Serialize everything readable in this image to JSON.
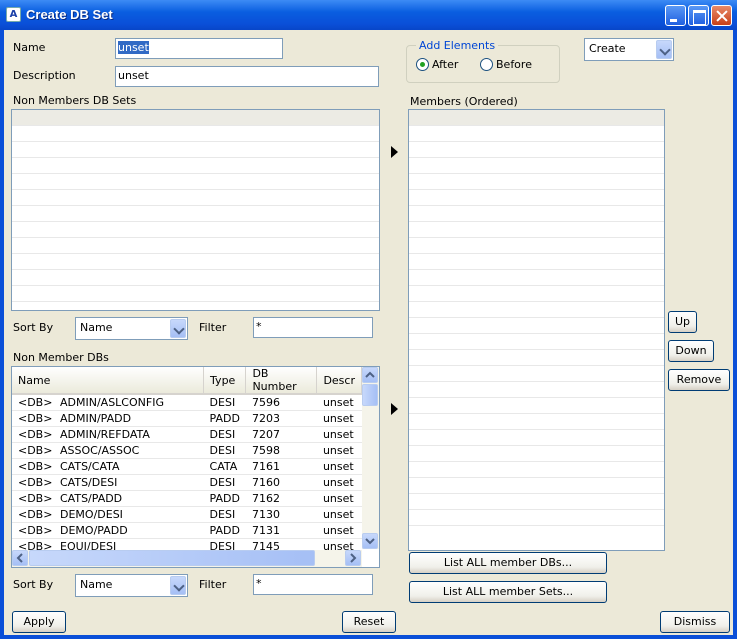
{
  "window": {
    "title": "Create DB Set",
    "app_icon_glyph": "A"
  },
  "form": {
    "name_label": "Name",
    "name_value": "unset",
    "description_label": "Description",
    "description_value": "unset"
  },
  "add_elements": {
    "group_title": "Add Elements",
    "after_label": "After",
    "before_label": "Before",
    "selected": "After"
  },
  "mode_combo": {
    "value": "Create"
  },
  "non_members_sets": {
    "label": "Non Members DB Sets"
  },
  "members": {
    "label": "Members (Ordered)"
  },
  "sort1": {
    "label": "Sort By",
    "value": "Name",
    "filter_label": "Filter",
    "filter_value": "*"
  },
  "non_member_dbs": {
    "label": "Non Member DBs",
    "columns": [
      "Name",
      "Type",
      "DB Number",
      "Descr"
    ],
    "rows": [
      [
        "<DB>",
        "ADMIN/ASLCONFIG",
        "DESI",
        "7596",
        "unset"
      ],
      [
        "<DB>",
        "ADMIN/PADD",
        "PADD",
        "7203",
        "unset"
      ],
      [
        "<DB>",
        "ADMIN/REFDATA",
        "DESI",
        "7207",
        "unset"
      ],
      [
        "<DB>",
        "ASSOC/ASSOC",
        "DESI",
        "7598",
        "unset"
      ],
      [
        "<DB>",
        "CATS/CATA",
        "CATA",
        "7161",
        "unset"
      ],
      [
        "<DB>",
        "CATS/DESI",
        "DESI",
        "7160",
        "unset"
      ],
      [
        "<DB>",
        "CATS/PADD",
        "PADD",
        "7162",
        "unset"
      ],
      [
        "<DB>",
        "DEMO/DESI",
        "DESI",
        "7130",
        "unset"
      ],
      [
        "<DB>",
        "DEMO/PADD",
        "PADD",
        "7131",
        "unset"
      ],
      [
        "<DB>",
        "EQUI/DESI",
        "DESI",
        "7145",
        "unset"
      ]
    ]
  },
  "sort2": {
    "label": "Sort By",
    "value": "Name",
    "filter_label": "Filter",
    "filter_value": "*"
  },
  "buttons": {
    "up": "Up",
    "down": "Down",
    "remove": "Remove",
    "list_member_dbs": "List ALL member DBs...",
    "list_member_sets": "List ALL member Sets...",
    "apply": "Apply",
    "reset": "Reset",
    "dismiss": "Dismiss"
  },
  "icons": {
    "move_right_1": "arrow-right-icon",
    "move_right_2": "arrow-right-icon",
    "scroll_up": "chevron-up-icon",
    "scroll_down": "chevron-down-icon",
    "scroll_left": "chevron-left-icon",
    "scroll_right": "chevron-right-icon"
  },
  "colors": {
    "titlebar": "#0a4fd8",
    "window_bg": "#ece9d8",
    "selection": "#316ac5",
    "group_title": "#0046d5"
  }
}
